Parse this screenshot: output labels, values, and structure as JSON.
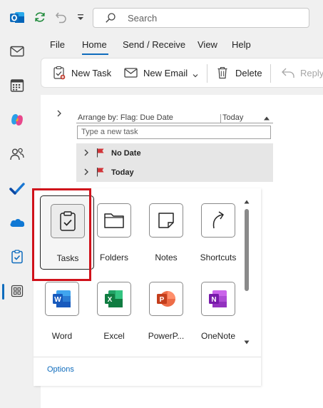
{
  "search": {
    "placeholder": "Search"
  },
  "menu": {
    "tabs": [
      {
        "label": "File"
      },
      {
        "label": "Home",
        "active": true
      },
      {
        "label": "Send / Receive"
      },
      {
        "label": "View"
      },
      {
        "label": "Help"
      }
    ]
  },
  "ribbon": {
    "new_task": "New Task",
    "new_email": "New Email",
    "delete": "Delete",
    "reply": "Reply"
  },
  "task_list": {
    "arrange_by": "Arrange by: Flag: Due Date",
    "sort_column": "Today",
    "new_task_placeholder": "Type a new task",
    "groups": [
      {
        "label": "No Date"
      },
      {
        "label": "Today"
      }
    ]
  },
  "launcher": {
    "apps": [
      {
        "label": "Tasks",
        "icon": "tasks-icon",
        "selected": true
      },
      {
        "label": "Folders",
        "icon": "folder-icon"
      },
      {
        "label": "Notes",
        "icon": "notes-icon"
      },
      {
        "label": "Shortcuts",
        "icon": "shortcut-icon"
      },
      {
        "label": "Word",
        "icon": "word-icon"
      },
      {
        "label": "Excel",
        "icon": "excel-icon"
      },
      {
        "label": "PowerP...",
        "icon": "powerpoint-icon"
      },
      {
        "label": "OneNote",
        "icon": "onenote-icon"
      }
    ],
    "options": "Options"
  },
  "colors": {
    "accent": "#0f6cbd",
    "highlight": "#d0121b",
    "word": "#185abd",
    "excel": "#107c41",
    "powerpoint": "#c43e1c",
    "onenote": "#7719aa"
  }
}
